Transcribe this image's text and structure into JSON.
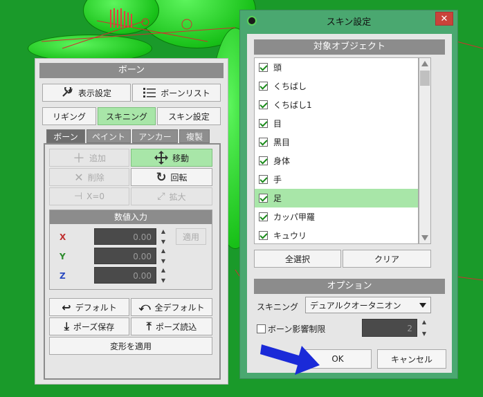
{
  "bone_panel": {
    "title": "ボーン",
    "display_settings": "表示設定",
    "bone_list": "ボーンリスト",
    "mode_buttons": [
      "リギング",
      "スキニング",
      "スキン設定"
    ],
    "tabs": [
      "ボーン",
      "ペイント",
      "アンカー",
      "複製"
    ],
    "tools": {
      "add": "追加",
      "move": "移動",
      "delete": "削除",
      "rotate": "回転",
      "x0": "X=0",
      "scale": "拡大"
    },
    "numeric_title": "数値入力",
    "apply": "適用",
    "axes": [
      {
        "label": "X",
        "value": "0.00",
        "color": "#c03030"
      },
      {
        "label": "Y",
        "value": "0.00",
        "color": "#2a8a2a"
      },
      {
        "label": "Z",
        "value": "0.00",
        "color": "#2a4ac0"
      }
    ],
    "default": "デフォルト",
    "all_default": "全デフォルト",
    "pose_save": "ポーズ保存",
    "pose_load": "ポーズ読込",
    "apply_transform": "変形を適用"
  },
  "skin_dialog": {
    "title": "スキン設定",
    "close": "✕",
    "objects_title": "対象オブジェクト",
    "objects": [
      {
        "label": "頭",
        "checked": true,
        "selected": false
      },
      {
        "label": "くちばし",
        "checked": true,
        "selected": false
      },
      {
        "label": "くちばし1",
        "checked": true,
        "selected": false
      },
      {
        "label": "目",
        "checked": true,
        "selected": false
      },
      {
        "label": "黒目",
        "checked": true,
        "selected": false
      },
      {
        "label": "身体",
        "checked": true,
        "selected": false
      },
      {
        "label": "手",
        "checked": true,
        "selected": false
      },
      {
        "label": "足",
        "checked": true,
        "selected": true
      },
      {
        "label": "カッパ甲羅",
        "checked": true,
        "selected": false
      },
      {
        "label": "キュウリ",
        "checked": true,
        "selected": false
      }
    ],
    "select_all": "全選択",
    "clear": "クリア",
    "options_title": "オプション",
    "skinning_label": "スキニング",
    "skinning_value": "デュアルクオータニオン",
    "bone_limit_label": "ボーン影響制限",
    "bone_limit_value": "2",
    "ok": "OK",
    "cancel": "キャンセル"
  },
  "colors": {
    "viewport_bg": "#1a9a2a",
    "dialog_frame": "#4aa870",
    "active_button": "#a8e6a8",
    "pointer_arrow": "#1a2ad8"
  }
}
